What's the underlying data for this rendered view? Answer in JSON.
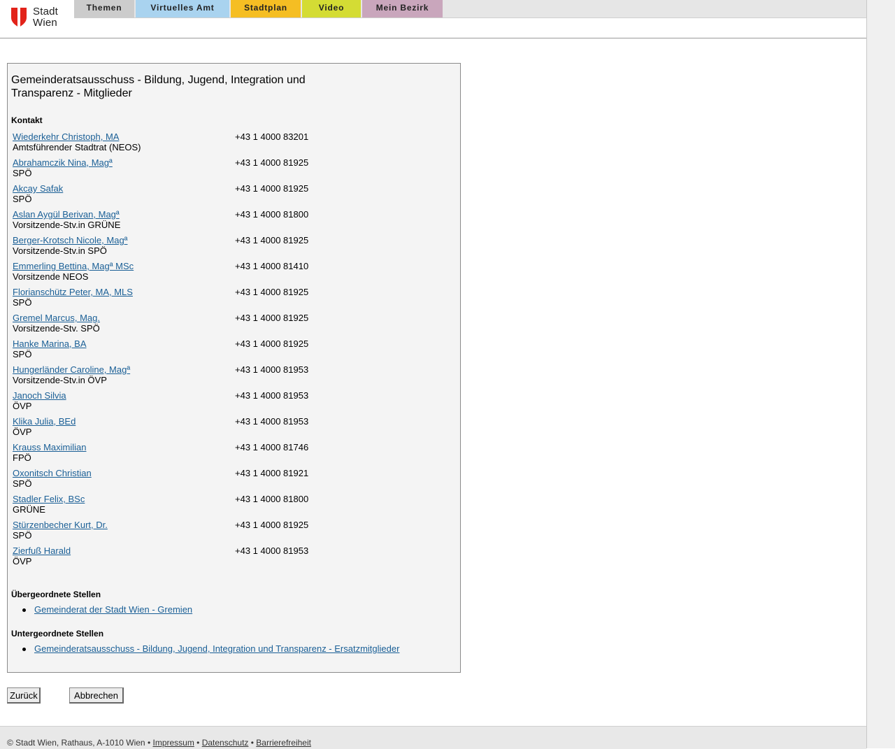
{
  "header": {
    "logo": {
      "line1": "Stadt",
      "line2": "Wien"
    },
    "tabs": [
      {
        "label": "Themen",
        "color": "#cccccc"
      },
      {
        "label": "Virtuelles Amt",
        "color": "#a9d3ef"
      },
      {
        "label": "Stadtplan",
        "color": "#f5be23"
      },
      {
        "label": "Video",
        "color": "#d4dc34"
      },
      {
        "label": "Mein Bezirk",
        "color": "#c9a6bc"
      }
    ]
  },
  "main": {
    "title": "Gemeinderatsausschuss - Bildung, Jugend, Integration und Transparenz - Mitglieder",
    "contact_label": "Kontakt",
    "members": [
      {
        "name": "Wiederkehr Christoph, MA",
        "role": "Amtsführender Stadtrat (NEOS)",
        "phone": "+43 1 4000 83201"
      },
      {
        "name": "Abrahamczik Nina, Magª",
        "role": "SPÖ",
        "phone": "+43 1 4000 81925"
      },
      {
        "name": "Akcay Safak",
        "role": "SPÖ",
        "phone": "+43 1 4000 81925"
      },
      {
        "name": "Aslan Aygül Berivan, Magª",
        "role": "Vorsitzende-Stv.in GRÜNE",
        "phone": "+43 1 4000 81800"
      },
      {
        "name": "Berger-Krotsch Nicole, Magª",
        "role": "Vorsitzende-Stv.in SPÖ",
        "phone": "+43 1 4000 81925"
      },
      {
        "name": "Emmerling Bettina, Magª MSc",
        "role": "Vorsitzende NEOS",
        "phone": "+43 1 4000 81410"
      },
      {
        "name": "Florianschütz Peter, MA, MLS",
        "role": "SPÖ",
        "phone": "+43 1 4000 81925"
      },
      {
        "name": "Gremel Marcus, Mag.",
        "role": "Vorsitzende-Stv. SPÖ",
        "phone": "+43 1 4000 81925"
      },
      {
        "name": "Hanke Marina, BA",
        "role": "SPÖ",
        "phone": "+43 1 4000 81925"
      },
      {
        "name": "Hungerländer Caroline, Magª",
        "role": "Vorsitzende-Stv.in ÖVP",
        "phone": "+43 1 4000 81953"
      },
      {
        "name": "Janoch Silvia",
        "role": "ÖVP",
        "phone": "+43 1 4000 81953"
      },
      {
        "name": "Klika Julia, BEd",
        "role": "ÖVP",
        "phone": "+43 1 4000 81953"
      },
      {
        "name": "Krauss Maximilian",
        "role": "FPÖ",
        "phone": "+43 1 4000 81746"
      },
      {
        "name": "Oxonitsch Christian",
        "role": "SPÖ",
        "phone": "+43 1 4000 81921"
      },
      {
        "name": "Stadler Felix, BSc",
        "role": "GRÜNE",
        "phone": "+43 1 4000 81800"
      },
      {
        "name": "Stürzenbecher Kurt, Dr.",
        "role": "SPÖ",
        "phone": "+43 1 4000 81925"
      },
      {
        "name": "Zierfuß Harald",
        "role": "ÖVP",
        "phone": "+43 1 4000 81953"
      }
    ],
    "parent_label": "Übergeordnete Stellen",
    "parent_links": [
      "Gemeinderat der Stadt Wien - Gremien"
    ],
    "child_label": "Untergeordnete Stellen",
    "child_links": [
      "Gemeinderatsausschuss - Bildung, Jugend, Integration und Transparenz - Ersatzmitglieder"
    ]
  },
  "buttons": {
    "back": "Zurück",
    "cancel": "Abbrechen"
  },
  "footer": {
    "copyright": "© Stadt Wien, Rathaus, A-1010 Wien",
    "sep": " • ",
    "links": [
      "Impressum",
      "Datenschutz",
      "Barrierefreiheit"
    ]
  }
}
